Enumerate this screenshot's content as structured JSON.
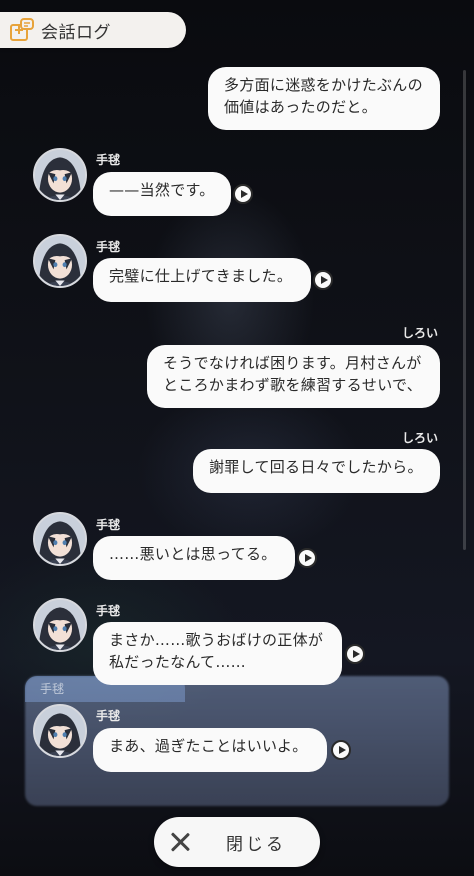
{
  "header": {
    "title": "会話ログ",
    "icon": "log-book-icon"
  },
  "messages": [
    {
      "speaker": "",
      "lines": [
        "多方面に迷惑をかけたぶんの",
        "価値はあったのだと。"
      ],
      "side": "right",
      "voice": false
    },
    {
      "speaker": "手毬",
      "lines": [
        "——当然です。"
      ],
      "side": "left",
      "voice": true
    },
    {
      "speaker": "手毬",
      "lines": [
        "完璧に仕上げてきました。"
      ],
      "side": "left",
      "voice": true
    },
    {
      "speaker": "しろい",
      "lines": [
        "そうでなければ困ります。月村さんが",
        "ところかまわず歌を練習するせいで、"
      ],
      "side": "right",
      "voice": false
    },
    {
      "speaker": "しろい",
      "lines": [
        "謝罪して回る日々でしたから。"
      ],
      "side": "right",
      "voice": false
    },
    {
      "speaker": "手毬",
      "lines": [
        "……悪いとは思ってる。"
      ],
      "side": "left",
      "voice": true
    },
    {
      "speaker": "手毬",
      "lines": [
        "まさか……歌うおばけの正体が",
        "私だったなんて……"
      ],
      "side": "left",
      "voice": true
    },
    {
      "speaker": "手毬",
      "lines": [
        "まあ、過ぎたことはいいよ。"
      ],
      "side": "left",
      "voice": true
    }
  ],
  "background_panel_label": "手毬",
  "close_button": {
    "label": "閉じる",
    "icon": "close-icon"
  },
  "colors": {
    "bubble": "#fafafa",
    "text": "#2a2a2a",
    "name": "#eaeaea",
    "header_bg": "#f3f1ee",
    "icon_accent": "#e7a33a"
  }
}
